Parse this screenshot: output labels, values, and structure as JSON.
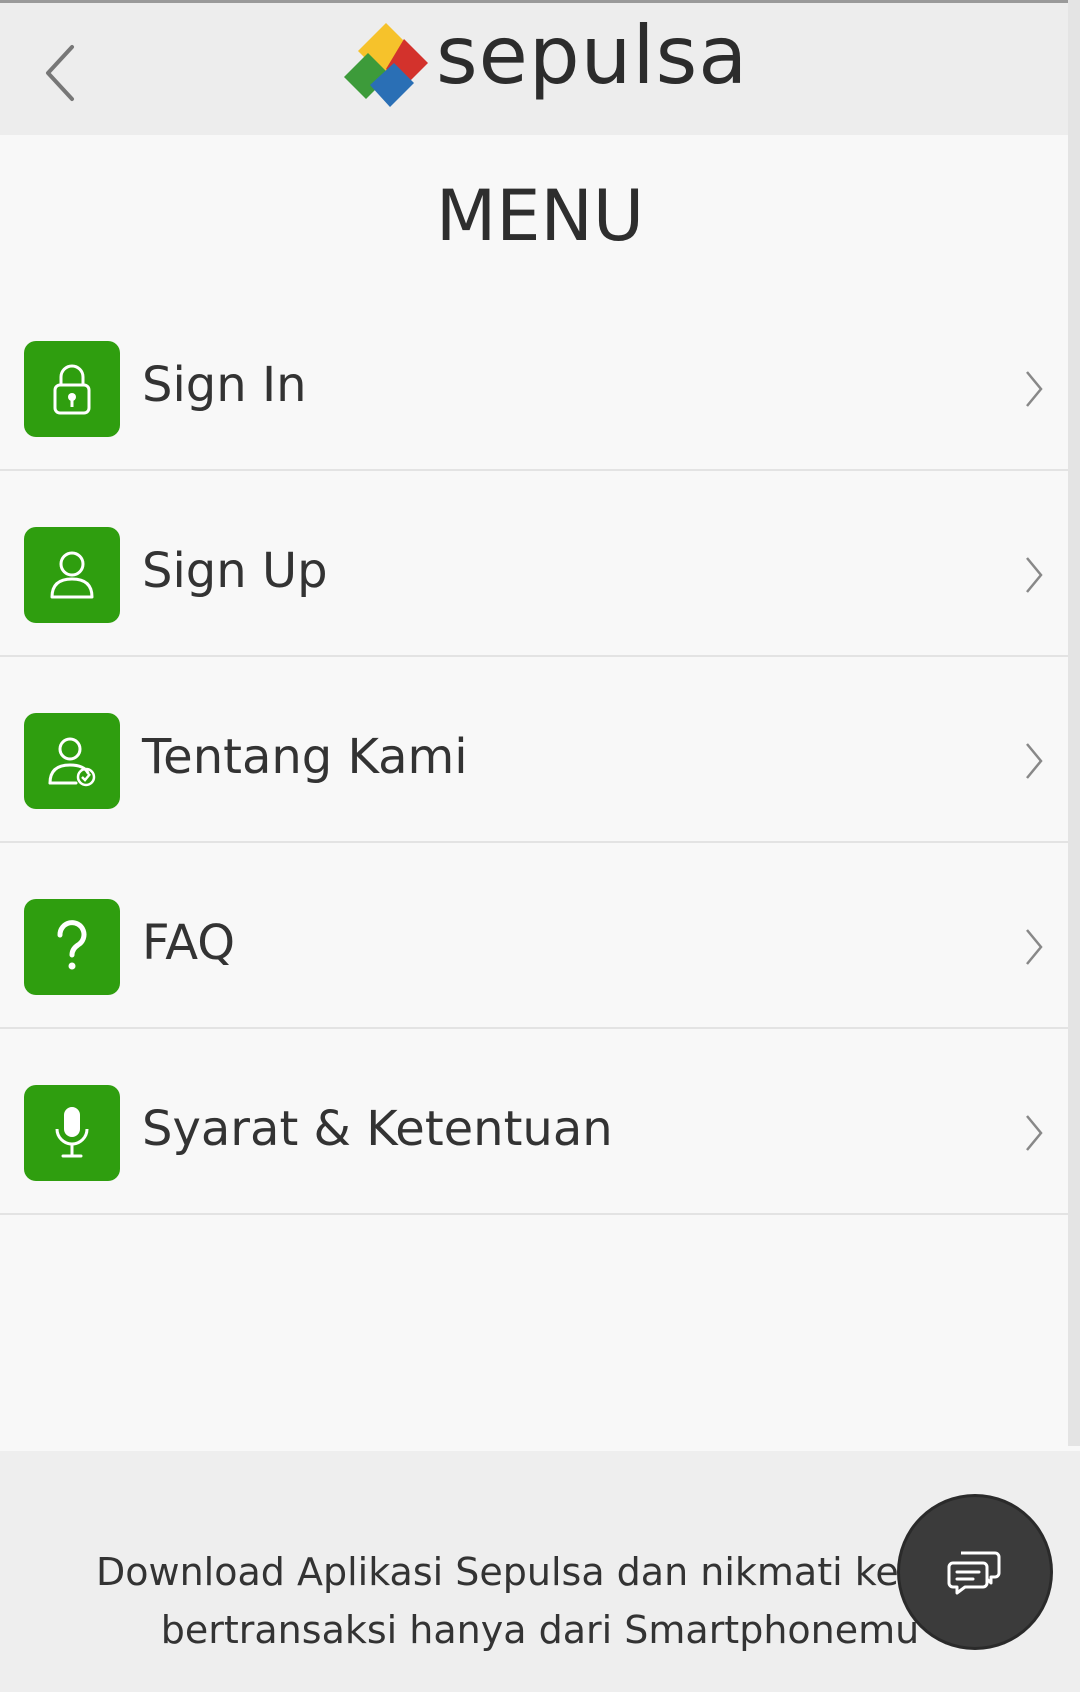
{
  "header": {
    "brand_name": "sepulsa",
    "back_icon": "chevron-left-icon"
  },
  "menu": {
    "title": "MENU",
    "items": [
      {
        "label": "Sign In",
        "icon": "lock-icon"
      },
      {
        "label": "Sign Up",
        "icon": "user-icon"
      },
      {
        "label": "Tentang Kami",
        "icon": "verified-user-icon"
      },
      {
        "label": "FAQ",
        "icon": "question-icon"
      },
      {
        "label": "Syarat & Ketentuan",
        "icon": "microphone-icon"
      }
    ]
  },
  "footer": {
    "line1": "Download Aplikasi Sepulsa dan nikmati kemud",
    "line2": "bertransaksi hanya dari Smartphonemu"
  },
  "chat": {
    "icon": "chat-bubbles-icon"
  },
  "colors": {
    "accent_green": "#2f9e0f",
    "header_bg": "#ededed",
    "page_bg": "#f8f8f8",
    "chat_bg": "#3b3b3b"
  }
}
